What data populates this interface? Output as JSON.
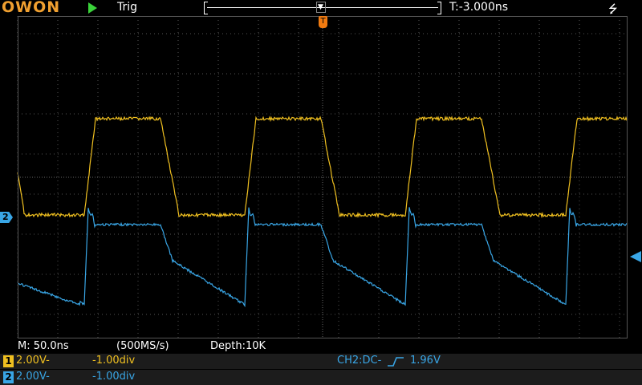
{
  "header": {
    "logo": "OWON",
    "run_state_icon": "play-icon",
    "trigger_label": "Trig",
    "time_offset": "T:-3.000ns",
    "usb_icon": "usb-icon"
  },
  "status": {
    "timebase": "M: 50.0ns",
    "sample_rate": "(500MS/s)",
    "depth": "Depth:10K"
  },
  "channels": [
    {
      "badge": "1",
      "scale": "2.00V-",
      "offset": "-1.00div",
      "color": "#f0c020"
    },
    {
      "badge": "2",
      "scale": "2.00V-",
      "offset": "-1.00div",
      "color": "#39a6e6"
    }
  ],
  "trigger": {
    "source_coupling": "CH2:DC-",
    "edge_icon": "rising-edge-icon",
    "level": "1.96V"
  },
  "markers": {
    "trigger_position": "T",
    "ch2_ground": "2"
  },
  "colors": {
    "ch1": "#f0c020",
    "ch2": "#39a6e6",
    "trigger": "#f07a10",
    "logo": "#f0a030"
  }
}
